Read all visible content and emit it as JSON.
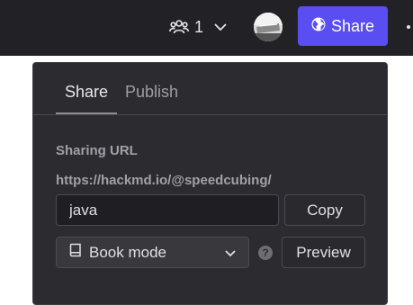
{
  "topbar": {
    "user_count": "1",
    "share_label": "Share",
    "icons": {
      "users": "users-icon",
      "dropdown": "chevron-down-icon",
      "globe": "globe-icon",
      "more": "more-icon"
    },
    "colors": {
      "background": "#222226",
      "share_button": "#5a4df2"
    }
  },
  "share_panel": {
    "tabs": [
      {
        "label": "Share",
        "active": true
      },
      {
        "label": "Publish",
        "active": false
      }
    ],
    "section_label": "Sharing URL",
    "url_prefix": "https://hackmd.io/@speedcubing/",
    "slug_value": "java",
    "copy_label": "Copy",
    "mode_select": {
      "selected": "Book mode",
      "icon": "book-icon"
    },
    "help_glyph": "?",
    "preview_label": "Preview",
    "colors": {
      "background": "#2c2c30",
      "input_background": "#1f1f23"
    }
  }
}
